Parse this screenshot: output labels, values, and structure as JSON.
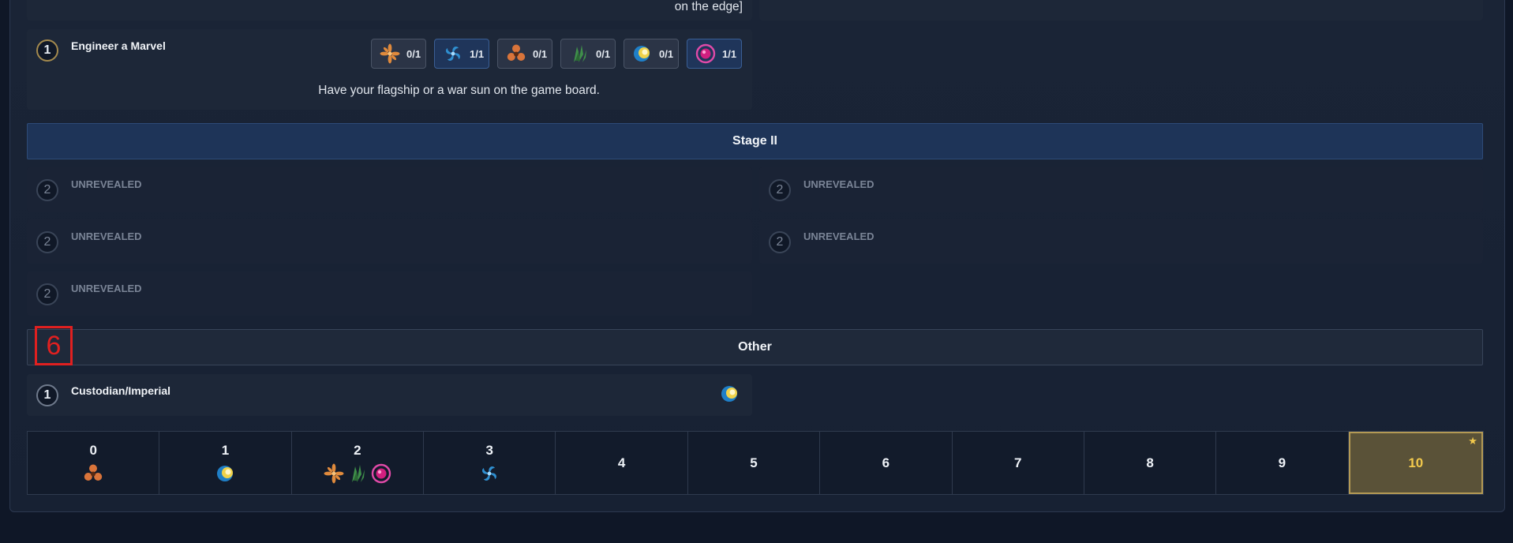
{
  "top_fragment": "on the edge]",
  "objective_engineer": {
    "points": "1",
    "title": "Engineer a Marvel",
    "description": "Have your flagship or a war sun on the game board.",
    "chips": [
      {
        "icon": "orange-flower-faction-icon",
        "value": "0/1",
        "done": false
      },
      {
        "icon": "blue-swirl-faction-icon",
        "value": "1/1",
        "done": true
      },
      {
        "icon": "orange-propeller-faction-icon",
        "value": "0/1",
        "done": false
      },
      {
        "icon": "green-claw-faction-icon",
        "value": "0/1",
        "done": false
      },
      {
        "icon": "blue-gold-orb-faction-icon",
        "value": "0/1",
        "done": false
      },
      {
        "icon": "pink-orb-faction-icon",
        "value": "1/1",
        "done": true
      }
    ]
  },
  "stage2": {
    "label": "Stage II",
    "unrevealed": [
      {
        "points": "2",
        "label": "UNREVEALED"
      },
      {
        "points": "2",
        "label": "UNREVEALED"
      },
      {
        "points": "2",
        "label": "UNREVEALED"
      },
      {
        "points": "2",
        "label": "UNREVEALED"
      },
      {
        "points": "2",
        "label": "UNREVEALED"
      }
    ]
  },
  "other": {
    "label": "Other",
    "marker": "6",
    "custodian": {
      "points": "1",
      "title": "Custodian/Imperial",
      "icon": "blue-gold-orb-faction-icon"
    }
  },
  "score_track": [
    {
      "value": "0",
      "icons": [
        "orange-propeller-faction-icon"
      ]
    },
    {
      "value": "1",
      "icons": [
        "blue-gold-orb-faction-icon"
      ]
    },
    {
      "value": "2",
      "icons": [
        "orange-flower-faction-icon",
        "green-claw-faction-icon",
        "pink-orb-faction-icon"
      ]
    },
    {
      "value": "3",
      "icons": [
        "blue-swirl-faction-icon"
      ]
    },
    {
      "value": "4",
      "icons": []
    },
    {
      "value": "5",
      "icons": []
    },
    {
      "value": "6",
      "icons": []
    },
    {
      "value": "7",
      "icons": []
    },
    {
      "value": "8",
      "icons": []
    },
    {
      "value": "9",
      "icons": []
    },
    {
      "value": "10",
      "icons": [],
      "goal": true
    }
  ],
  "colors": {
    "gold": "#f2c94c",
    "marker_red": "#e02020",
    "stage_blue": "#1e3458"
  }
}
